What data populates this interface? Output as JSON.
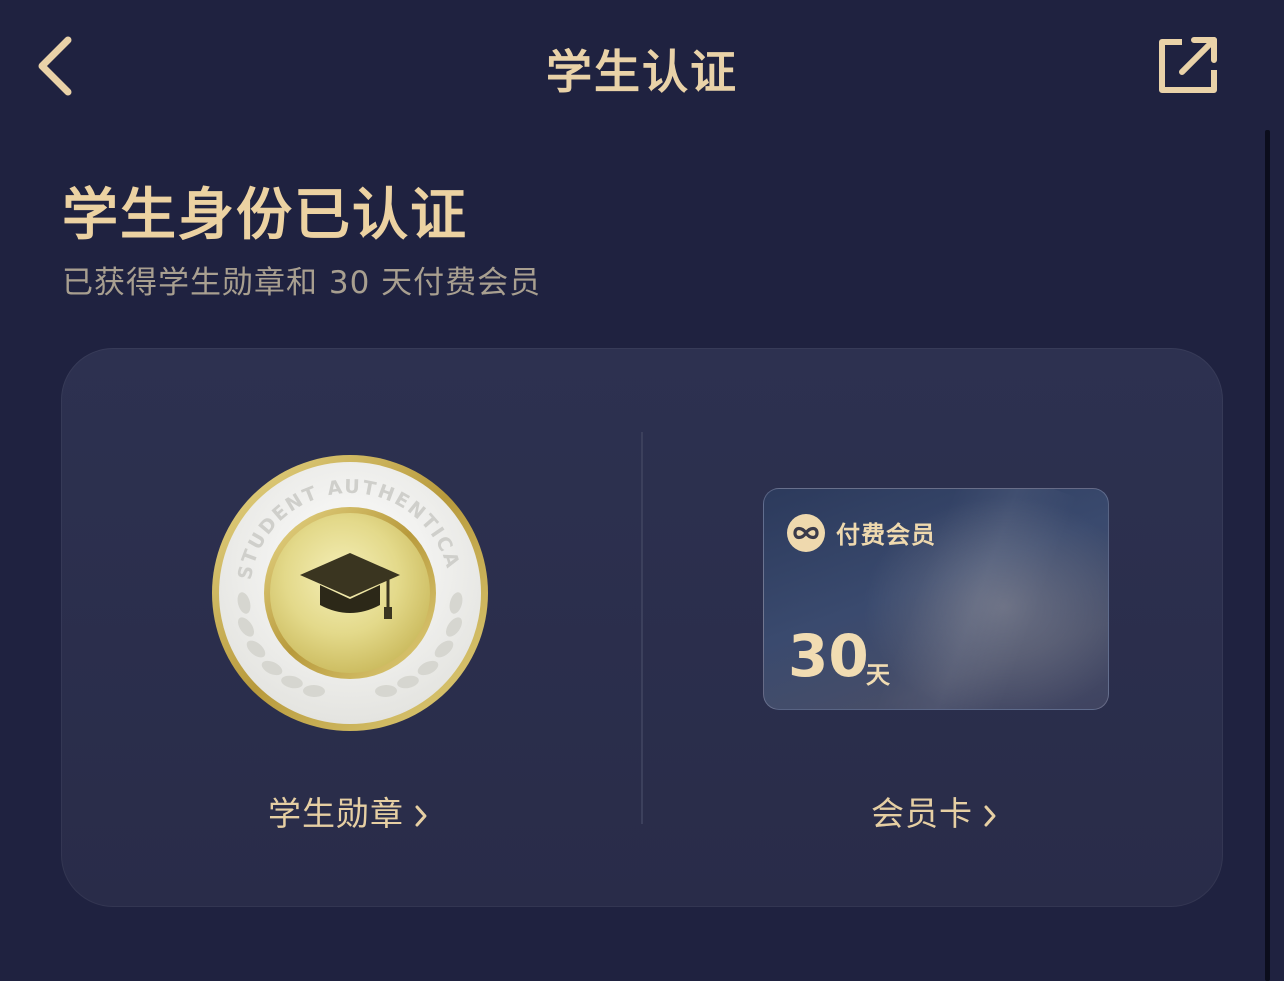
{
  "nav": {
    "title": "学生认证"
  },
  "header": {
    "title": "学生身份已认证",
    "subtitle": "已获得学生勋章和 30 天付费会员"
  },
  "badge": {
    "ring_text": "STUDENT AUTHENTICA",
    "link_label": "学生勋章"
  },
  "membership": {
    "card_title": "付费会员",
    "days": "30",
    "unit": "天",
    "link_label": "会员卡"
  },
  "icons": {
    "back": "chevron-left-icon",
    "share": "share-external-icon",
    "cap": "graduation-cap-icon",
    "laurel": "laurel-wreath-icon",
    "infinity": "infinity-icon",
    "chevron": "chevron-right-icon"
  },
  "colors": {
    "background": "#1f2240",
    "accent_gold": "#e9d2a8",
    "panel": "#2d3150",
    "muted_text": "#a89f90"
  }
}
